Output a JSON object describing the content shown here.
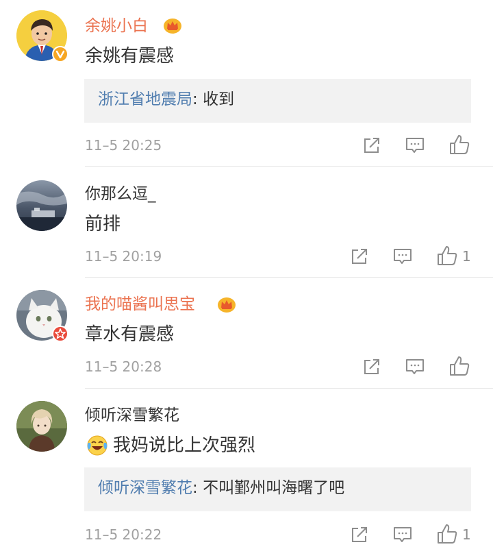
{
  "colors": {
    "vip_name": "#eb7350",
    "reply_user": "#507daf",
    "meta": "#a0a0a0",
    "reply_bg": "#f2f2f2"
  },
  "comments": [
    {
      "username": "余姚小白",
      "username_style": "vip",
      "has_crown": true,
      "avatar_badge": "verified-v-icon",
      "text": "余姚有震感",
      "reply": {
        "user": "浙江省地震局",
        "sep": ": ",
        "content": "收到"
      },
      "time": "11–5 20:25",
      "like_count": ""
    },
    {
      "username": "你那么逗_",
      "username_style": "normal",
      "has_crown": false,
      "text": "前排",
      "time": "11–5 20:19",
      "like_count": "1"
    },
    {
      "username": "我的喵酱叫思宝",
      "username_style": "vip",
      "has_crown": true,
      "avatar_badge": "star-badge-icon",
      "text": "章水有震感",
      "time": "11–5 20:28",
      "like_count": ""
    },
    {
      "username": "倾听深雪繁花",
      "username_style": "normal",
      "has_crown": false,
      "emoji": "laugh-cry-emoji",
      "text": "我妈说比上次强烈",
      "reply": {
        "user": "倾听深雪繁花",
        "sep": ": ",
        "content": "不叫鄞州叫海曙了吧"
      },
      "time": "11–5 20:22",
      "like_count": "1"
    }
  ]
}
